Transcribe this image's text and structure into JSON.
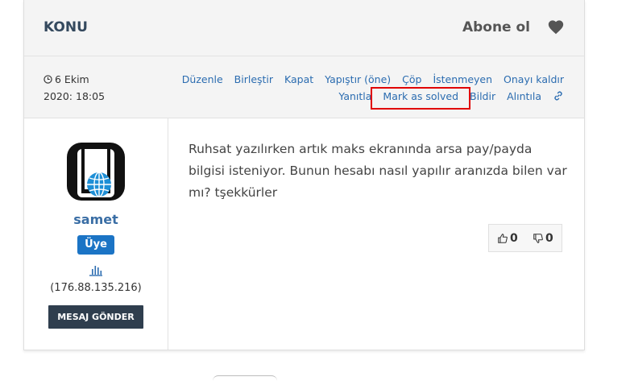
{
  "header": {
    "title": "KONU",
    "subscribe_label": "Abone ol"
  },
  "post": {
    "date_line1": "6 Ekim",
    "date_line2": "2020: 18:05",
    "actions_row1": [
      "Düzenle",
      "Birleştir",
      "Kapat",
      "Yapıştır (öne)",
      "Çöp",
      "İstenmeyen",
      "Onayı kaldır"
    ],
    "actions_row2": [
      "Yanıtla",
      "Mark as solved",
      "Bildir",
      "Alıntıla"
    ],
    "body": "Ruhsat yazılırken artık maks ekranında arsa pay/payda bilgisi isteniyor. Bunun hesabı nasıl yapılır aranızda bilen var mı? tşekkürler",
    "upvotes": "0",
    "downvotes": "0"
  },
  "author": {
    "username": "samet",
    "role_badge": "Üye",
    "ip": "(176.88.135.216)",
    "message_button": "MESAJ GÖNDER"
  },
  "colors": {
    "link": "#2b6cb0",
    "badge": "#1b74c5",
    "highlight": "#e00000",
    "button": "#2f3e4e"
  }
}
